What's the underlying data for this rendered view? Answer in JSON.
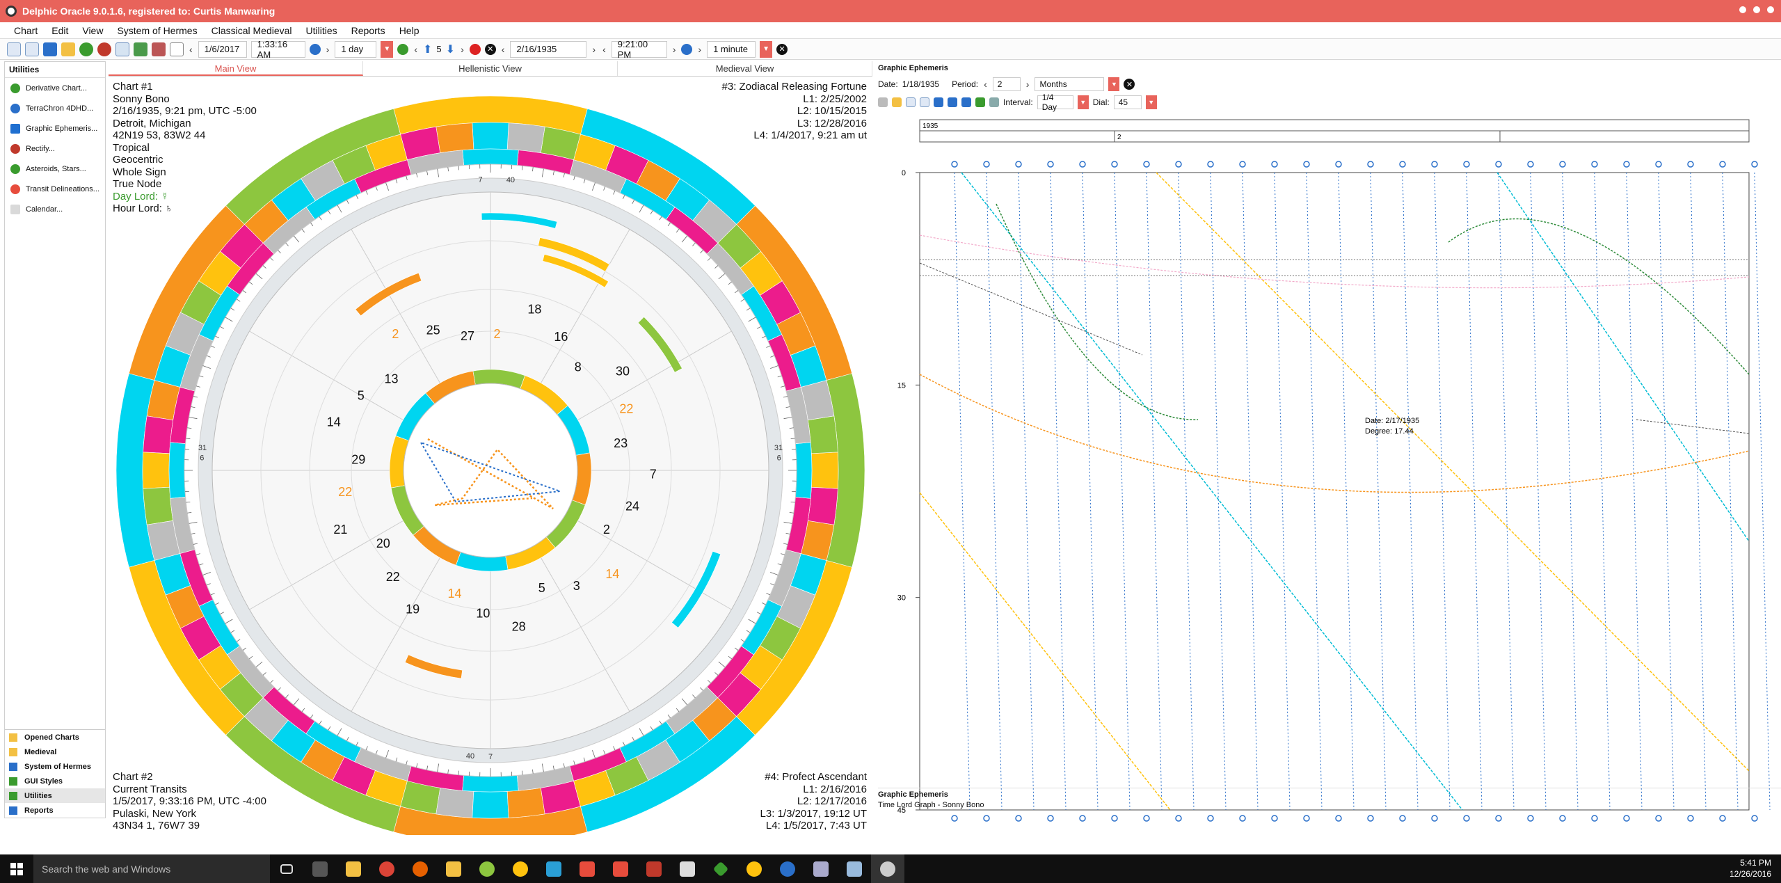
{
  "window": {
    "title": "Delphic Oracle 9.0.1.6, registered to: Curtis Manwaring"
  },
  "menu": [
    "Chart",
    "Edit",
    "View",
    "System of Hermes",
    "Classical Medieval",
    "Utilities",
    "Reports",
    "Help"
  ],
  "toolbar": {
    "date1": "1/6/2017",
    "time1": "1:33:16 AM",
    "step1": "1 day",
    "count": "5",
    "date2": "2/16/1935",
    "time2": "9:21:00 PM",
    "step2": "1 minute"
  },
  "sidebar": {
    "title": "Utilities",
    "items": [
      "Derivative Chart...",
      "TerraChron 4DHD...",
      "Graphic Ephemeris...",
      "Rectify...",
      "Asteroids, Stars...",
      "Transit Delineations...",
      "Calendar..."
    ],
    "groups": [
      "Opened Charts",
      "Medieval",
      "System of Hermes",
      "GUI Styles",
      "Utilities",
      "Reports"
    ]
  },
  "tabs": [
    "Main View",
    "Hellenistic View",
    "Medieval View"
  ],
  "chart1": {
    "lines": [
      "Chart #1",
      "Sonny Bono",
      "2/16/1935, 9:21 pm, UTC -5:00",
      "Detroit, Michigan",
      "42N19 53, 83W2 44",
      "Tropical",
      "Geocentric",
      "Whole Sign",
      "True Node"
    ],
    "day_lord": "Day Lord: ☿",
    "hour_lord": "Hour Lord: ♄"
  },
  "releasing": [
    "#3: Zodiacal Releasing Fortune",
    "L1: 2/25/2002",
    "L2: 10/15/2015",
    "L3: 12/28/2016",
    "L4: 1/4/2017, 9:21 am ut"
  ],
  "chart2": [
    "Chart #2",
    "Current Transits",
    "1/5/2017, 9:33:16 PM, UTC -4:00",
    "Pulaski, New York",
    "43N34 1, 76W7 39"
  ],
  "profect": [
    "#4: Profect Ascendant",
    "L1: 2/16/2016",
    "L2: 12/17/2016",
    "L3: 1/3/2017, 19:12 UT",
    "L4: 1/5/2017, 7:43 UT"
  ],
  "wheel": {
    "inner_numbers": [
      "27",
      "25",
      "2",
      "13",
      "5",
      "14",
      "29",
      "22",
      "21",
      "20",
      "22",
      "19",
      "14",
      "10",
      "28",
      "5",
      "3",
      "14",
      "2",
      "24",
      "7",
      "23",
      "22",
      "30",
      "8",
      "16",
      "18",
      "2"
    ],
    "degree_marks": [
      "7",
      "40",
      "6",
      "31",
      "6",
      "31",
      "7",
      "40"
    ]
  },
  "ephemeris": {
    "title": "Graphic Ephemeris",
    "date_label": "Date:",
    "date": "1/18/1935",
    "period_label": "Period:",
    "period": "2",
    "unit": "Months",
    "interval_label": "Interval:",
    "interval": "1/4 Day",
    "dial_label": "Dial:",
    "dial": "45",
    "year": "1935",
    "month": "2",
    "y_ticks": [
      "0",
      "15",
      "30",
      "45"
    ],
    "tooltip": [
      "Date: 2/17/1935",
      "Degree: 17.44"
    ],
    "footer_title": "Graphic Ephemeris",
    "footer_sub": "Time Lord Graph - Sonny Bono"
  },
  "taskbar": {
    "search": "Search the web and Windows",
    "time": "5:41 PM",
    "date": "12/26/2016"
  },
  "colors": {
    "titlebar": "#e8635b",
    "orange": "#f7941d",
    "yellow": "#ffc20e",
    "green": "#8dc63f",
    "cyan": "#00d5f0",
    "magenta": "#ec1c8c",
    "gray": "#bdbdbd"
  }
}
